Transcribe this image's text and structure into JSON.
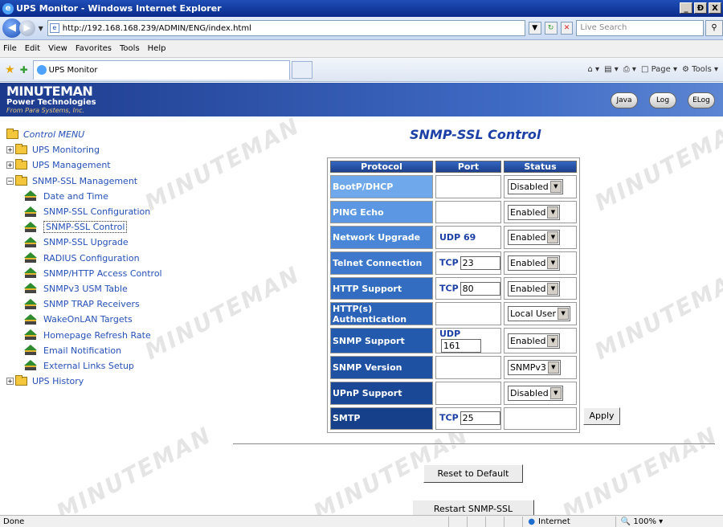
{
  "window": {
    "title": "UPS Monitor - Windows Internet Explorer",
    "buttons": [
      "_",
      "Ɖ",
      "X"
    ]
  },
  "address": {
    "url": "http://192.168.168.239/ADMIN/ENG/index.html",
    "search_placeholder": "Live Search"
  },
  "menubar": [
    "File",
    "Edit",
    "View",
    "Favorites",
    "Tools",
    "Help"
  ],
  "tab": {
    "title": "UPS Monitor"
  },
  "toolbar": {
    "page": "Page",
    "tools": "Tools"
  },
  "brand": {
    "line1": "MINUTEMAN",
    "line2": "Power Technologies",
    "line3": "From Para Systems, Inc."
  },
  "header_buttons": [
    "Java",
    "Log",
    "ELog"
  ],
  "menu": {
    "root": "Control MENU",
    "items": [
      {
        "label": "UPS Monitoring",
        "type": "folder"
      },
      {
        "label": "UPS Management",
        "type": "folder"
      },
      {
        "label": "SNMP-SSL Management",
        "type": "folder-open"
      },
      {
        "label": "Date and Time",
        "type": "leaf"
      },
      {
        "label": "SNMP-SSL Configuration",
        "type": "leaf"
      },
      {
        "label": "SNMP-SSL Control",
        "type": "leaf",
        "selected": true
      },
      {
        "label": "SNMP-SSL Upgrade",
        "type": "leaf"
      },
      {
        "label": "RADIUS Configuration",
        "type": "leaf"
      },
      {
        "label": "SNMP/HTTP Access Control",
        "type": "leaf"
      },
      {
        "label": "SNMPv3 USM Table",
        "type": "leaf"
      },
      {
        "label": "SNMP TRAP Receivers",
        "type": "leaf"
      },
      {
        "label": "WakeOnLAN Targets",
        "type": "leaf"
      },
      {
        "label": "Homepage Refresh Rate",
        "type": "leaf"
      },
      {
        "label": "Email Notification",
        "type": "leaf"
      },
      {
        "label": "External Links Setup",
        "type": "leaf"
      },
      {
        "label": "UPS History",
        "type": "folder"
      }
    ]
  },
  "content": {
    "title": "SNMP-SSL Control",
    "headers": [
      "Protocol",
      "Port",
      "Status"
    ],
    "rows": [
      {
        "protocol": "BootP/DHCP",
        "port_prefix": "",
        "port_value": "",
        "status": "Disabled",
        "color": "#6fa9ec"
      },
      {
        "protocol": "PING Echo",
        "port_prefix": "",
        "port_value": "",
        "status": "Enabled",
        "color": "#5c97e3"
      },
      {
        "protocol": "Network Upgrade",
        "port_prefix": "UDP 69",
        "port_value": "",
        "status": "Enabled",
        "color": "#4a86d8"
      },
      {
        "protocol": "Telnet Connection",
        "port_prefix": "TCP",
        "port_value": "23",
        "status": "Enabled",
        "color": "#3d78cd"
      },
      {
        "protocol": "HTTP Support",
        "port_prefix": "TCP",
        "port_value": "80",
        "status": "Enabled",
        "color": "#336dc2"
      },
      {
        "protocol": "HTTP(s) Authentication",
        "port_prefix": "",
        "port_value": "",
        "status": "Local User",
        "color": "#2a63b8"
      },
      {
        "protocol": "SNMP Support",
        "port_prefix": "UDP",
        "port_value": "161",
        "status": "Enabled",
        "color": "#245aad"
      },
      {
        "protocol": "SNMP Version",
        "port_prefix": "",
        "port_value": "",
        "status": "SNMPv3",
        "color": "#1f51a2"
      },
      {
        "protocol": "UPnP Support",
        "port_prefix": "",
        "port_value": "",
        "status": "Disabled",
        "color": "#1b4896"
      },
      {
        "protocol": "SMTP",
        "port_prefix": "TCP",
        "port_value": "25",
        "status": "",
        "color": "#17408a"
      }
    ],
    "apply_label": "Apply",
    "reset_label": "Reset to Default",
    "restart_label": "Restart SNMP-SSL"
  },
  "status": {
    "left": "Done",
    "zone": "Internet",
    "zoom": "100%"
  }
}
